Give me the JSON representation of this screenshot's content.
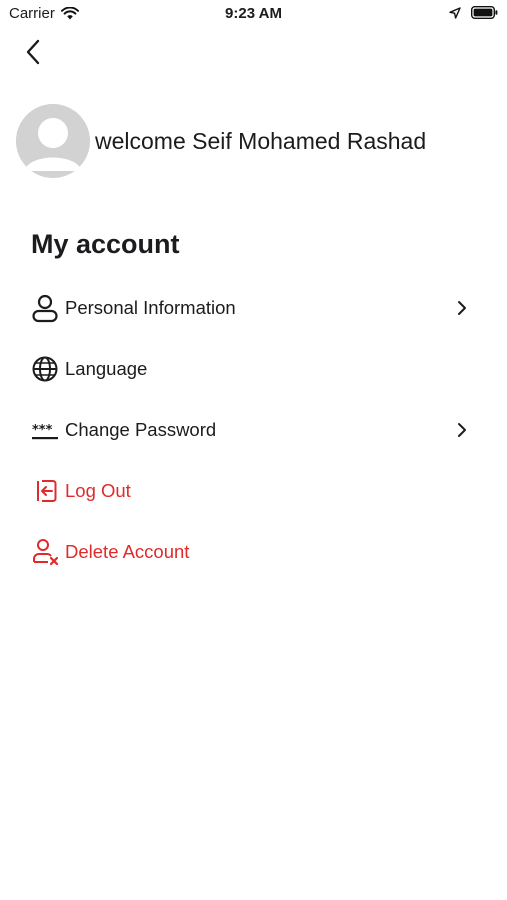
{
  "status_bar": {
    "carrier": "Carrier",
    "time": "9:23 AM"
  },
  "profile": {
    "welcome_text": "welcome Seif Mohamed Rashad"
  },
  "section": {
    "title": "My account"
  },
  "menu": {
    "items": [
      {
        "label": "Personal Information",
        "icon": "person-icon"
      },
      {
        "label": "Language",
        "icon": "globe-icon"
      },
      {
        "label": "Change Password",
        "icon": "password-icon"
      },
      {
        "label": "Log Out",
        "icon": "logout-icon"
      },
      {
        "label": "Delete Account",
        "icon": "delete-user-icon"
      }
    ]
  },
  "colors": {
    "danger": "#e02b2b",
    "text": "#1c1c1e",
    "avatar_bg": "#d2d2d2"
  }
}
